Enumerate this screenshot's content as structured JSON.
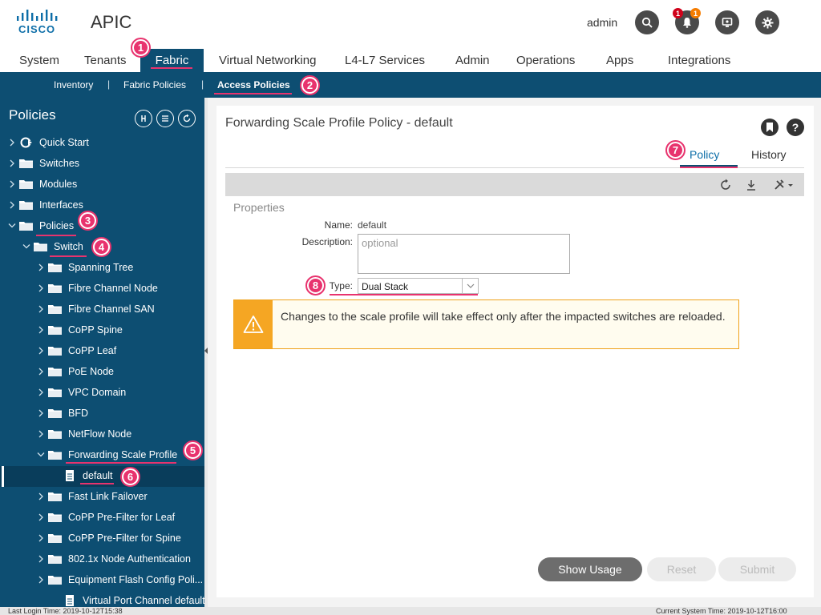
{
  "header": {
    "app_name": "APIC",
    "user": "admin",
    "notification_badges": [
      "1",
      "1"
    ],
    "colors": {
      "brand": "#0d4e72",
      "accent": "#e8336e",
      "badge_red": "#d0021b",
      "badge_orange": "#f57c00"
    }
  },
  "main_nav": {
    "tabs": [
      {
        "label": "System"
      },
      {
        "label": "Tenants"
      },
      {
        "label": "Fabric",
        "active": true
      },
      {
        "label": "Virtual Networking"
      },
      {
        "label": "L4-L7 Services"
      },
      {
        "label": "Admin"
      },
      {
        "label": "Operations"
      },
      {
        "label": "Apps"
      },
      {
        "label": "Integrations"
      }
    ]
  },
  "sub_nav": {
    "items": [
      "Inventory",
      "Fabric Policies",
      "Access Policies"
    ],
    "separator": "|",
    "active": "Access Policies"
  },
  "sidebar": {
    "title": "Policies",
    "tree": [
      {
        "label": "Quick Start",
        "icon": "quick-start-icon"
      },
      {
        "label": "Switches",
        "icon": "folder-icon"
      },
      {
        "label": "Modules",
        "icon": "folder-icon"
      },
      {
        "label": "Interfaces",
        "icon": "folder-icon"
      },
      {
        "label": "Policies",
        "icon": "folder-icon",
        "expanded": true
      },
      {
        "label": "Switch",
        "icon": "folder-icon",
        "expanded": true
      },
      {
        "label": "Spanning Tree",
        "icon": "folder-icon"
      },
      {
        "label": "Fibre Channel Node",
        "icon": "folder-icon"
      },
      {
        "label": "Fibre Channel SAN",
        "icon": "folder-icon"
      },
      {
        "label": "CoPP Spine",
        "icon": "folder-icon"
      },
      {
        "label": "CoPP Leaf",
        "icon": "folder-icon"
      },
      {
        "label": "PoE Node",
        "icon": "folder-icon"
      },
      {
        "label": "VPC Domain",
        "icon": "folder-icon"
      },
      {
        "label": "BFD",
        "icon": "folder-icon"
      },
      {
        "label": "NetFlow Node",
        "icon": "folder-icon"
      },
      {
        "label": "Forwarding Scale Profile",
        "icon": "folder-icon",
        "expanded": true
      },
      {
        "label": "default",
        "icon": "document-icon",
        "selected": true
      },
      {
        "label": "Fast Link Failover",
        "icon": "folder-icon"
      },
      {
        "label": "CoPP Pre-Filter for Leaf",
        "icon": "folder-icon"
      },
      {
        "label": "CoPP Pre-Filter for Spine",
        "icon": "folder-icon"
      },
      {
        "label": "802.1x Node Authentication",
        "icon": "folder-icon"
      },
      {
        "label": "Equipment Flash Config Poli...",
        "icon": "folder-icon"
      },
      {
        "label": "Virtual Port Channel default",
        "icon": "document-icon"
      }
    ]
  },
  "callouts": [
    "1",
    "2",
    "3",
    "4",
    "5",
    "6",
    "7",
    "8"
  ],
  "panel": {
    "title": "Forwarding Scale Profile Policy - default",
    "tabs": [
      "Policy",
      "History"
    ],
    "active_tab": "Policy",
    "properties_header": "Properties",
    "fields": {
      "name_label": "Name:",
      "name_value": "default",
      "description_label": "Description:",
      "description_placeholder": "optional",
      "type_label": "Type:",
      "type_value": "Dual Stack"
    },
    "alert": {
      "text": "Changes to the scale profile will take effect only after the impacted switches are reloaded.",
      "icon": "warning-icon"
    },
    "buttons": {
      "show_usage": "Show Usage",
      "reset": "Reset",
      "submit": "Submit"
    }
  },
  "footer": {
    "last_login": "Last Login Time: 2019-10-12T15:38",
    "current_time": "Current System Time: 2019-10-12T16:00"
  }
}
